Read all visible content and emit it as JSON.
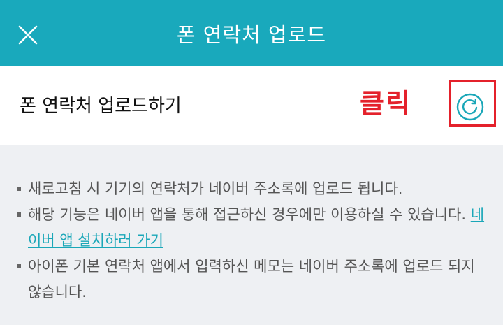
{
  "header": {
    "title": "폰 연락처 업로드",
    "close_icon": "close-icon"
  },
  "upload_row": {
    "label": "폰 연락처 업로드하기",
    "annotation": "클릭",
    "refresh_icon": "refresh-icon"
  },
  "info": {
    "items": [
      {
        "text": "새로고침 시 기기의 연락처가 네이버 주소록에 업로드 됩니다."
      },
      {
        "text": "해당 기능은 네이버 앱을 통해 접근하신 경우에만 이용하실 수 있습니다. ",
        "link": "네이버 앱 설치하러 가기"
      },
      {
        "text": "아이폰 기본 연락처 앱에서 입력하신 메모는 네이버 주소록에 업로드 되지 않습니다."
      }
    ]
  },
  "colors": {
    "header_bg": "#19a9bc",
    "accent": "#1aa7b8",
    "annotation_red": "#e4212b",
    "page_bg": "#eef0f3"
  }
}
